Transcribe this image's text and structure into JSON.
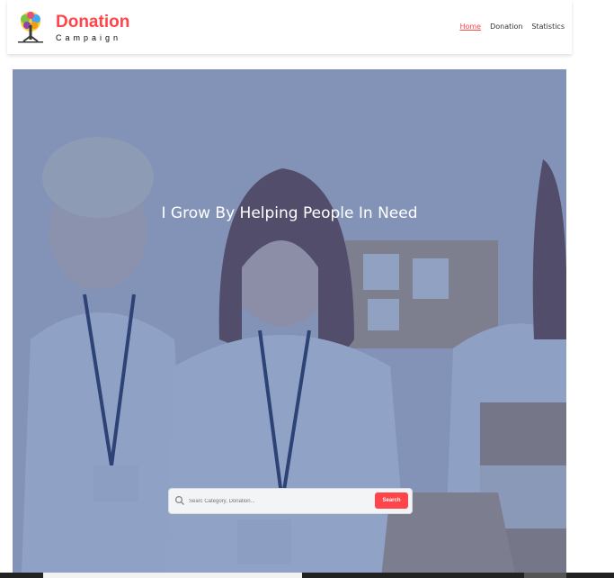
{
  "header": {
    "brand_title": "Donation",
    "brand_subtitle": "Campaign",
    "nav": [
      {
        "label": "Home",
        "active": true
      },
      {
        "label": "Donation",
        "active": false
      },
      {
        "label": "Statistics",
        "active": false
      }
    ]
  },
  "hero": {
    "headline": "I Grow By Helping People In Need",
    "search_placeholder": "Searc Category, Donation...",
    "search_button": "Search",
    "overlay_color": "#3e5ca0"
  },
  "colors": {
    "accent": "#ff444a",
    "text_dark": "#0b0b0b"
  },
  "icons": [
    "tree-logo-icon",
    "search-icon"
  ]
}
